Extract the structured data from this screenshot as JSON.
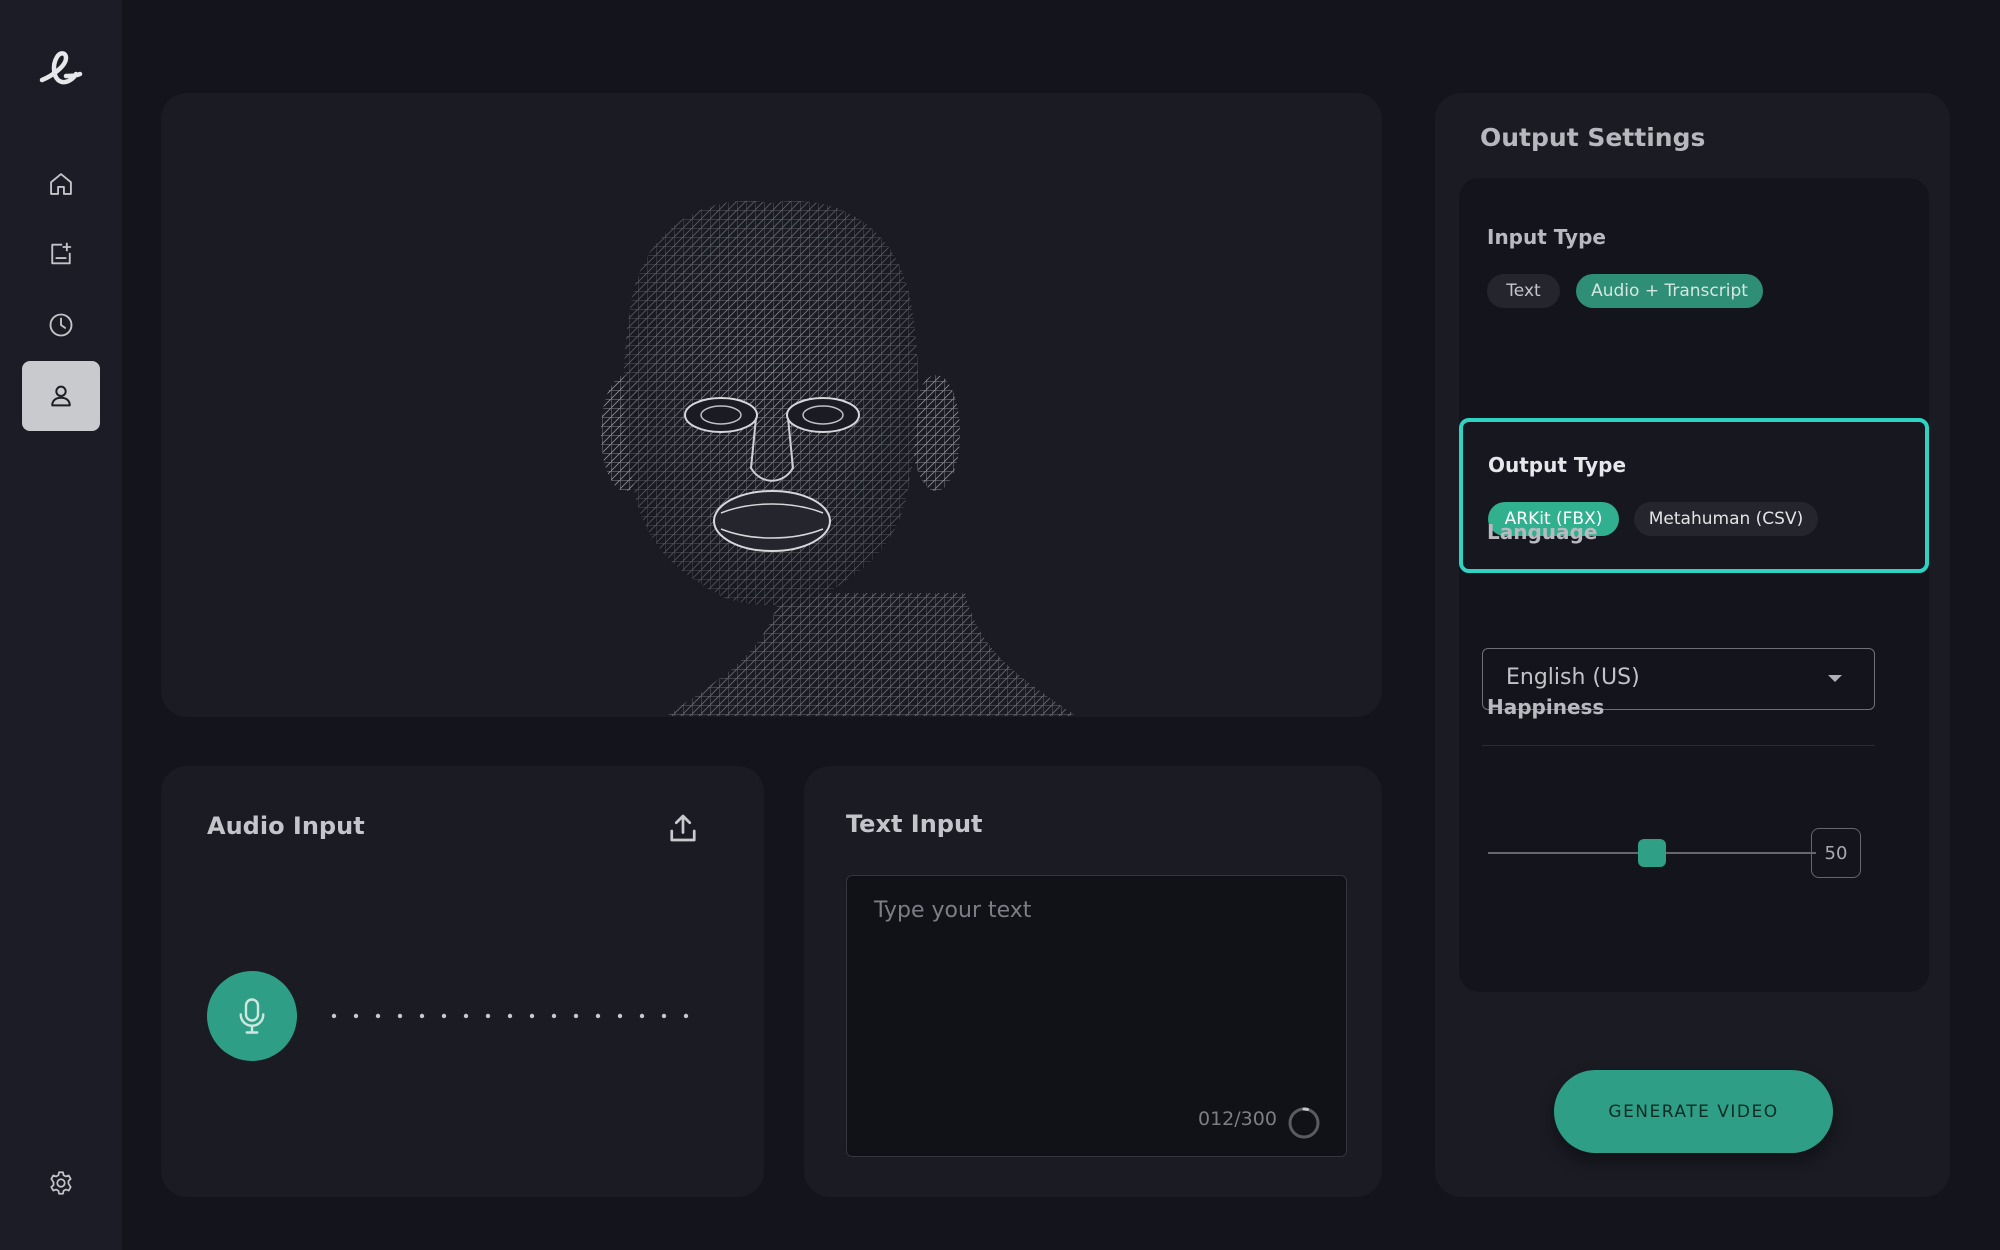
{
  "app": {
    "logo_icon": "cursive-e-logo",
    "accent_color": "#2e9f86",
    "highlight_color": "#2fd3c2"
  },
  "sidebar": {
    "items": [
      {
        "icon": "home-icon",
        "active": false
      },
      {
        "icon": "new-project-icon",
        "active": false
      },
      {
        "icon": "history-clock-icon",
        "active": false
      },
      {
        "icon": "profile-icon",
        "active": true
      }
    ],
    "settings_icon": "gear-icon"
  },
  "viewer": {
    "content": "wireframe-head-icon"
  },
  "audio_input": {
    "title": "Audio Input",
    "upload_icon": "upload-icon",
    "mic_icon": "microphone-icon"
  },
  "text_input": {
    "title": "Text Input",
    "placeholder": "Type  your text",
    "char_count": "012/300",
    "progress": 0.04
  },
  "output_settings": {
    "title": "Output Settings",
    "input_type": {
      "label": "Input Type",
      "options": [
        "Text",
        "Audio + Transcript"
      ],
      "selected": "Audio + Transcript"
    },
    "output_type": {
      "label": "Output Type",
      "options": [
        "ARKit (FBX)",
        "Metahuman (CSV)"
      ],
      "selected": "ARKit (FBX)"
    },
    "language": {
      "label": "Language",
      "value": "English (US)"
    },
    "happiness": {
      "label": "Happiness",
      "value": "50",
      "min": 0,
      "max": 100
    },
    "generate_label": "GENERATE VIDEO"
  }
}
